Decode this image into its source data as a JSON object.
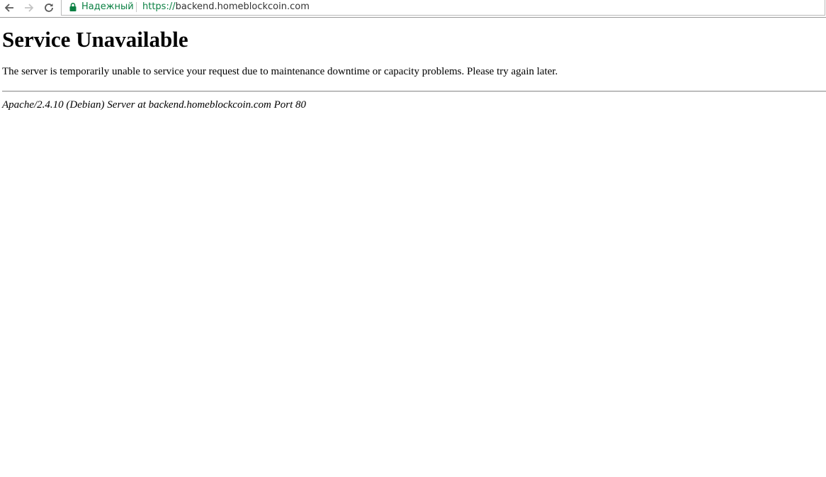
{
  "browser": {
    "nav": {
      "back_icon": "back-arrow-icon",
      "forward_icon": "forward-arrow-icon",
      "reload_icon": "reload-icon"
    },
    "omnibox": {
      "lock_icon": "lock-icon",
      "security_label": "Надежный",
      "url_scheme": "https://",
      "url_rest": "backend.homeblockcoin.com"
    },
    "colors": {
      "secure": "#0b8043",
      "nav_enabled": "#5a5a5a",
      "nav_disabled": "#c4c4c4"
    }
  },
  "page": {
    "title": "Service Unavailable",
    "message": "The server is temporarily unable to service your request due to maintenance downtime or capacity problems. Please try again later.",
    "server_signature": "Apache/2.4.10 (Debian) Server at backend.homeblockcoin.com Port 80"
  }
}
